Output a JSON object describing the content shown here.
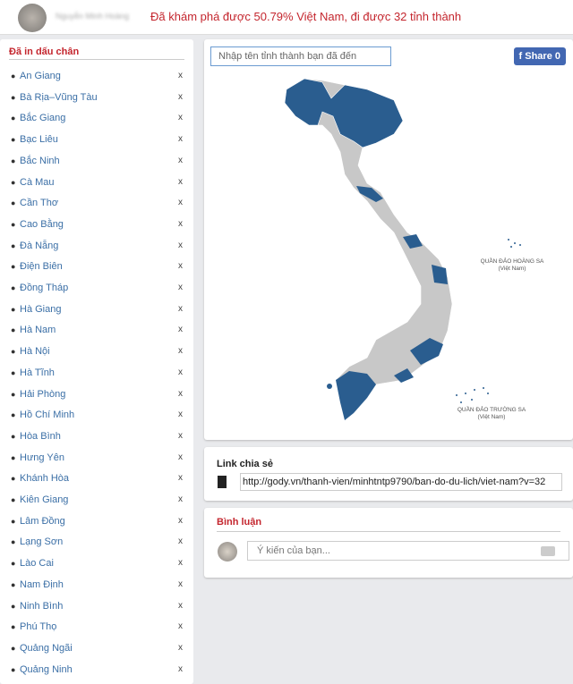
{
  "header": {
    "user_name": "Nguyễn Minh Hoàng",
    "headline": "Đã khám phá được 50.79% Việt Nam, đi được 32 tỉnh thành"
  },
  "sidebar": {
    "title": "Đã in dấu chân",
    "remove_label": "x",
    "items": [
      "An Giang",
      "Bà Rịa–Vũng Tàu",
      "Bắc Giang",
      "Bạc Liêu",
      "Bắc Ninh",
      "Cà Mau",
      "Cần Thơ",
      "Cao Bằng",
      "Đà Nẵng",
      "Điện Biên",
      "Đồng Tháp",
      "Hà Giang",
      "Hà Nam",
      "Hà Nội",
      "Hà Tĩnh",
      "Hải Phòng",
      "Hồ Chí Minh",
      "Hòa Bình",
      "Hưng Yên",
      "Khánh Hòa",
      "Kiên Giang",
      "Lâm Đồng",
      "Lạng Sơn",
      "Lào Cai",
      "Nam Định",
      "Ninh Bình",
      "Phú Thọ",
      "Quảng Ngãi",
      "Quảng Ninh"
    ]
  },
  "map": {
    "search_placeholder": "Nhập tên tỉnh thành bạn đã đến",
    "share_label": "Share 0",
    "visited_color": "#2a5d8f",
    "unvisited_color": "#c8c8c8",
    "hoang_sa": "QUẦN ĐẢO HOÀNG SA",
    "hoang_sa_sub": "(Việt Nam)",
    "truong_sa": "QUẦN ĐẢO TRƯỜNG SA",
    "truong_sa_sub": "(Việt Nam)"
  },
  "share_link": {
    "title": "Link chia sẻ",
    "url": "http://gody.vn/thanh-vien/minhtntp9790/ban-do-du-lich/viet-nam?v=32"
  },
  "comments": {
    "title": "Bình luận",
    "placeholder": "Ý kiến của bạn..."
  }
}
